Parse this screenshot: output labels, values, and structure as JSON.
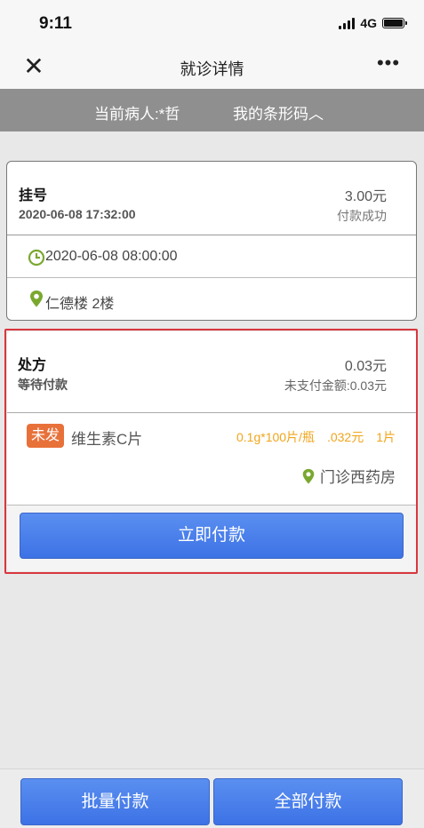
{
  "status_bar": {
    "time": "9:11",
    "network": "4G"
  },
  "nav": {
    "title": "就诊详情",
    "close_icon": "close-icon",
    "more_icon": "more-icon"
  },
  "patient_bar": {
    "patient_text": "当前病人:*哲",
    "barcode_text": "我的条形码︿"
  },
  "registration": {
    "title": "挂号",
    "datetime": "2020-06-08 17:32:00",
    "amount": "3.00元",
    "status": "付款成功",
    "appointment_time": "2020-06-08 08:00:00",
    "location": "仁德楼 2楼"
  },
  "prescription": {
    "title": "处方",
    "status": "等待付款",
    "amount": "0.03元",
    "unpaid": "未支付金额:0.03元",
    "drug": {
      "badge": "未发",
      "name": "维生素C片",
      "spec": "0.1g*100片/瓶",
      "price": ".032元",
      "quantity": "1片"
    },
    "pharmacy": "门诊西药房",
    "pay_button": "立即付款"
  },
  "bottom": {
    "batch_pay": "批量付款",
    "pay_all": "全部付款"
  },
  "colors": {
    "accent_blue": "#4a80eb",
    "badge_orange": "#e8713a",
    "spec_yellow": "#f0a51c",
    "icon_green": "#7aa82f",
    "highlight_red": "#d9363e"
  }
}
